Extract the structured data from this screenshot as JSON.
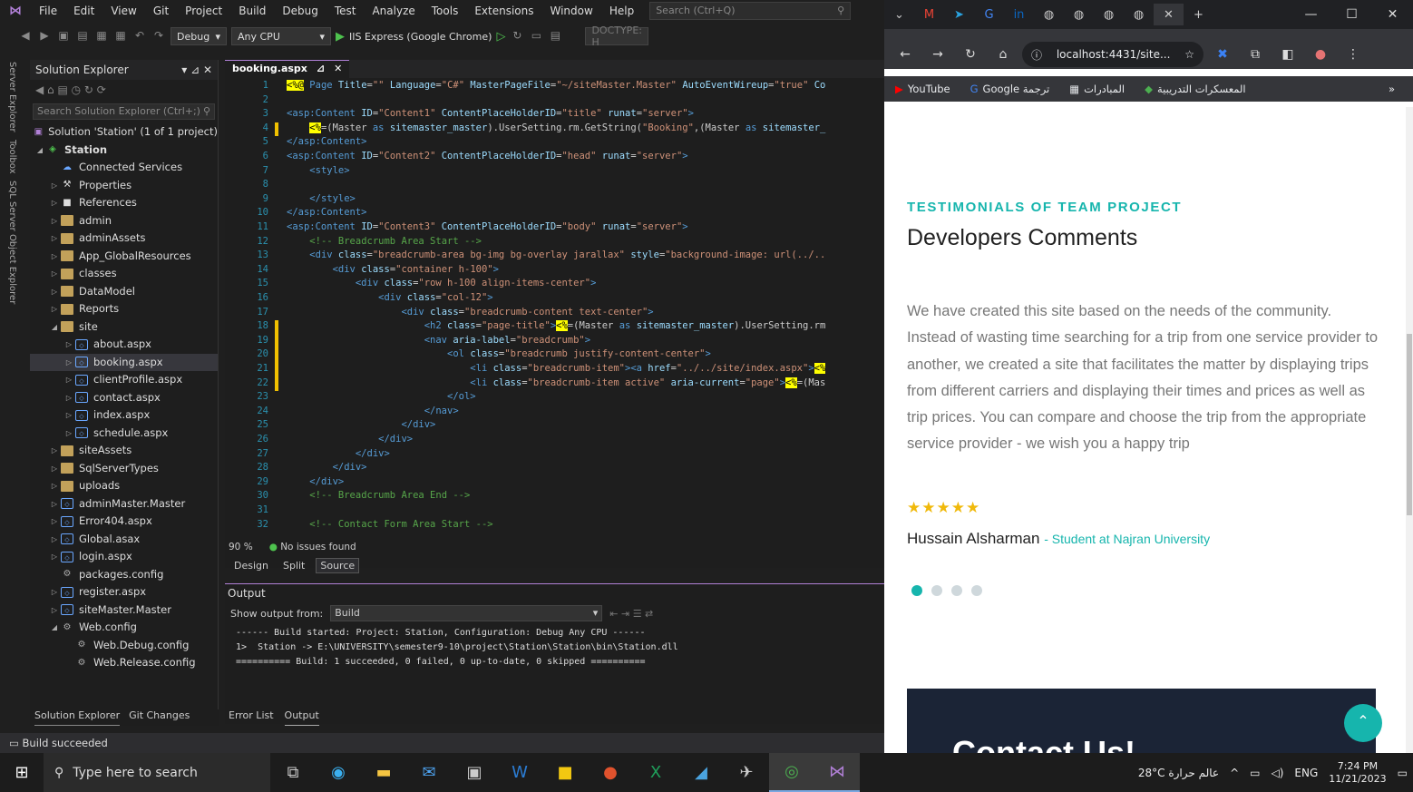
{
  "vs": {
    "menus": [
      "File",
      "Edit",
      "View",
      "Git",
      "Project",
      "Build",
      "Debug",
      "Test",
      "Analyze",
      "Tools",
      "Extensions",
      "Window",
      "Help"
    ],
    "search_placeholder": "Search (Ctrl+Q)",
    "config": "Debug",
    "platform": "Any CPU",
    "run_target": "IIS Express (Google Chrome)",
    "doctype": "DOCTYPE: H",
    "side_tabs": [
      "Server Explorer",
      "Toolbox",
      "SQL Server Object Explorer"
    ],
    "solution_explorer": {
      "title": "Solution Explorer",
      "search": "Search Solution Explorer (Ctrl+;)",
      "items": [
        {
          "label": "Solution 'Station' (1 of 1 project)",
          "lvl": 0,
          "kind": "sol",
          "tw": ""
        },
        {
          "label": "Station",
          "lvl": 0,
          "kind": "proj",
          "tw": "◢"
        },
        {
          "label": "Connected Services",
          "lvl": 1,
          "kind": "svc",
          "tw": ""
        },
        {
          "label": "Properties",
          "lvl": 1,
          "kind": "prop",
          "tw": "▷"
        },
        {
          "label": "References",
          "lvl": 1,
          "kind": "ref",
          "tw": "▷"
        },
        {
          "label": "admin",
          "lvl": 1,
          "kind": "folder",
          "tw": "▷"
        },
        {
          "label": "adminAssets",
          "lvl": 1,
          "kind": "folder",
          "tw": "▷"
        },
        {
          "label": "App_GlobalResources",
          "lvl": 1,
          "kind": "folder",
          "tw": "▷"
        },
        {
          "label": "classes",
          "lvl": 1,
          "kind": "folder",
          "tw": "▷"
        },
        {
          "label": "DataModel",
          "lvl": 1,
          "kind": "folder",
          "tw": "▷"
        },
        {
          "label": "Reports",
          "lvl": 1,
          "kind": "folder",
          "tw": "▷"
        },
        {
          "label": "site",
          "lvl": 1,
          "kind": "folder",
          "tw": "◢"
        },
        {
          "label": "about.aspx",
          "lvl": 2,
          "kind": "file",
          "tw": "▷"
        },
        {
          "label": "booking.aspx",
          "lvl": 2,
          "kind": "file",
          "tw": "▷",
          "sel": true
        },
        {
          "label": "clientProfile.aspx",
          "lvl": 2,
          "kind": "file",
          "tw": "▷"
        },
        {
          "label": "contact.aspx",
          "lvl": 2,
          "kind": "file",
          "tw": "▷"
        },
        {
          "label": "index.aspx",
          "lvl": 2,
          "kind": "file",
          "tw": "▷"
        },
        {
          "label": "schedule.aspx",
          "lvl": 2,
          "kind": "file",
          "tw": "▷"
        },
        {
          "label": "siteAssets",
          "lvl": 1,
          "kind": "folder",
          "tw": "▷"
        },
        {
          "label": "SqlServerTypes",
          "lvl": 1,
          "kind": "folder",
          "tw": "▷"
        },
        {
          "label": "uploads",
          "lvl": 1,
          "kind": "folder",
          "tw": "▷"
        },
        {
          "label": "adminMaster.Master",
          "lvl": 1,
          "kind": "file",
          "tw": "▷"
        },
        {
          "label": "Error404.aspx",
          "lvl": 1,
          "kind": "file",
          "tw": "▷"
        },
        {
          "label": "Global.asax",
          "lvl": 1,
          "kind": "file",
          "tw": "▷"
        },
        {
          "label": "login.aspx",
          "lvl": 1,
          "kind": "file",
          "tw": "▷"
        },
        {
          "label": "packages.config",
          "lvl": 1,
          "kind": "cfg",
          "tw": ""
        },
        {
          "label": "register.aspx",
          "lvl": 1,
          "kind": "file",
          "tw": "▷"
        },
        {
          "label": "siteMaster.Master",
          "lvl": 1,
          "kind": "file",
          "tw": "▷"
        },
        {
          "label": "Web.config",
          "lvl": 1,
          "kind": "cfg",
          "tw": "◢"
        },
        {
          "label": "Web.Debug.config",
          "lvl": 2,
          "kind": "cfg",
          "tw": ""
        },
        {
          "label": "Web.Release.config",
          "lvl": 2,
          "kind": "cfg",
          "tw": ""
        }
      ],
      "bottom_tabs": [
        "Solution Explorer",
        "Git Changes"
      ]
    },
    "editor": {
      "tab": "booking.aspx",
      "lines": [
        {
          "n": "1",
          "h": "<span class='yb'>&lt;%@</span> <span class='kw'>Page</span> <span class='at'>Title</span>=<span class='st'>\"\"</span> <span class='at'>Language</span>=<span class='st'>\"C#\"</span> <span class='at'>MasterPageFile</span>=<span class='st'>\"~/siteMaster.Master\"</span> <span class='at'>AutoEventWireup</span>=<span class='st'>\"true\"</span> <span class='at'>Co</span>"
        },
        {
          "n": "2",
          "h": ""
        },
        {
          "n": "3",
          "h": "<span class='kw'>&lt;asp:Content</span> <span class='at'>ID</span>=<span class='st'>\"Content1\"</span> <span class='at'>ContentPlaceHolderID</span>=<span class='st'>\"title\"</span> <span class='at'>runat</span>=<span class='st'>\"server\"</span><span class='kw'>&gt;</span>"
        },
        {
          "n": "4",
          "h": "    <span class='yb'>&lt;%</span>=(Master <span class='kw'>as</span> <span class='at'>sitemaster_master</span>).UserSetting.rm.GetString(<span class='st'>\"Booking\"</span>,(Master <span class='kw'>as</span> <span class='at'>sitemaster_</span>"
        },
        {
          "n": "5",
          "h": "<span class='kw'>&lt;/asp:Content&gt;</span>"
        },
        {
          "n": "6",
          "h": "<span class='kw'>&lt;asp:Content</span> <span class='at'>ID</span>=<span class='st'>\"Content2\"</span> <span class='at'>ContentPlaceHolderID</span>=<span class='st'>\"head\"</span> <span class='at'>runat</span>=<span class='st'>\"server\"</span><span class='kw'>&gt;</span>"
        },
        {
          "n": "7",
          "h": "    <span class='kw'>&lt;style&gt;</span>"
        },
        {
          "n": "8",
          "h": ""
        },
        {
          "n": "9",
          "h": "    <span class='kw'>&lt;/style&gt;</span>"
        },
        {
          "n": "10",
          "h": "<span class='kw'>&lt;/asp:Content&gt;</span>"
        },
        {
          "n": "11",
          "h": "<span class='kw'>&lt;asp:Content</span> <span class='at'>ID</span>=<span class='st'>\"Content3\"</span> <span class='at'>ContentPlaceHolderID</span>=<span class='st'>\"body\"</span> <span class='at'>runat</span>=<span class='st'>\"server\"</span><span class='kw'>&gt;</span>"
        },
        {
          "n": "12",
          "h": "    <span class='cm'>&lt;!-- Breadcrumb Area Start --&gt;</span>"
        },
        {
          "n": "13",
          "h": "    <span class='kw'>&lt;div</span> <span class='at'>class</span>=<span class='st'>\"breadcrumb-area bg-img bg-overlay jarallax\"</span> <span class='at'>style</span>=<span class='st'>\"background-image: url(../..</span>"
        },
        {
          "n": "14",
          "h": "        <span class='kw'>&lt;div</span> <span class='at'>class</span>=<span class='st'>\"container h-100\"</span><span class='kw'>&gt;</span>"
        },
        {
          "n": "15",
          "h": "            <span class='kw'>&lt;div</span> <span class='at'>class</span>=<span class='st'>\"row h-100 align-items-center\"</span><span class='kw'>&gt;</span>"
        },
        {
          "n": "16",
          "h": "                <span class='kw'>&lt;div</span> <span class='at'>class</span>=<span class='st'>\"col-12\"</span><span class='kw'>&gt;</span>"
        },
        {
          "n": "17",
          "h": "                    <span class='kw'>&lt;div</span> <span class='at'>class</span>=<span class='st'>\"breadcrumb-content text-center\"</span><span class='kw'>&gt;</span>"
        },
        {
          "n": "18",
          "h": "                        <span class='kw'>&lt;h2</span> <span class='at'>class</span>=<span class='st'>\"page-title\"</span><span class='kw'>&gt;</span><span class='yb'>&lt;%</span>=(Master <span class='kw'>as</span> <span class='at'>sitemaster_master</span>).UserSetting.rm"
        },
        {
          "n": "19",
          "h": "                        <span class='kw'>&lt;nav</span> <span class='at'>aria-label</span>=<span class='st'>\"breadcrumb\"</span><span class='kw'>&gt;</span>"
        },
        {
          "n": "20",
          "h": "                            <span class='kw'>&lt;ol</span> <span class='at'>class</span>=<span class='st'>\"breadcrumb justify-content-center\"</span><span class='kw'>&gt;</span>"
        },
        {
          "n": "21",
          "h": "                                <span class='kw'>&lt;li</span> <span class='at'>class</span>=<span class='st'>\"breadcrumb-item\"</span><span class='kw'>&gt;&lt;a</span> <span class='at'>href</span>=<span class='st'>\"../../site/index.aspx\"</span><span class='kw'>&gt;</span><span class='yb'>&lt;%</span>"
        },
        {
          "n": "22",
          "h": "                                <span class='kw'>&lt;li</span> <span class='at'>class</span>=<span class='st'>\"breadcrumb-item active\"</span> <span class='at'>aria-current</span>=<span class='st'>\"page\"</span><span class='kw'>&gt;</span><span class='yb'>&lt;%</span>=(Mas"
        },
        {
          "n": "23",
          "h": "                            <span class='kw'>&lt;/ol&gt;</span>"
        },
        {
          "n": "24",
          "h": "                        <span class='kw'>&lt;/nav&gt;</span>"
        },
        {
          "n": "25",
          "h": "                    <span class='kw'>&lt;/div&gt;</span>"
        },
        {
          "n": "26",
          "h": "                <span class='kw'>&lt;/div&gt;</span>"
        },
        {
          "n": "27",
          "h": "            <span class='kw'>&lt;/div&gt;</span>"
        },
        {
          "n": "28",
          "h": "        <span class='kw'>&lt;/div&gt;</span>"
        },
        {
          "n": "29",
          "h": "    <span class='kw'>&lt;/div&gt;</span>"
        },
        {
          "n": "30",
          "h": "    <span class='cm'>&lt;!-- Breadcrumb Area End --&gt;</span>"
        },
        {
          "n": "31",
          "h": ""
        },
        {
          "n": "32",
          "h": "    <span class='cm'>&lt;!-- Contact Form Area Start --&gt;</span>"
        }
      ],
      "zoom": "90 %",
      "issues": "No issues found",
      "view_tabs": [
        "Design",
        "Split",
        "Source"
      ]
    },
    "output": {
      "title": "Output",
      "show_from_label": "Show output from:",
      "source": "Build",
      "lines": [
        "------ Build started: Project: Station, Configuration: Debug Any CPU ------",
        "1>  Station -> E:\\UNIVERSITY\\semester9-10\\project\\Station\\Station\\bin\\Station.dll",
        "========== Build: 1 succeeded, 0 failed, 0 up-to-date, 0 skipped =========="
      ],
      "bottom_tabs": [
        "Error List",
        "Output"
      ]
    },
    "status": "Build succeeded"
  },
  "chrome": {
    "url": "localhost:4431/site...",
    "bookmarks": [
      "YouTube",
      "Google ترجمة",
      "المبادرات",
      "المعسكرات التدريبية"
    ],
    "page": {
      "kicker": "TESTIMONIALS OF TEAM PROJECT",
      "title": "Developers Comments",
      "body": "We have created this site based on the needs of the community. Instead of wasting time searching for a trip from one service provider to another, we created a site that facilitates the matter by displaying trips from different carriers and displaying their times and prices as well as trip prices. You can compare and choose the trip from the appropriate service provider - we wish you a happy trip",
      "rating": 5,
      "stars": "★★★★★",
      "author": "Hussain Alsharman",
      "role": "Student at Najran University",
      "slide_count": 4,
      "active_slide": 1,
      "contact_heading": "Contact Us!"
    }
  },
  "taskbar": {
    "search": "Type here to search",
    "weather": "28°C عالم حرارة",
    "lang": "ENG",
    "time": "7:24 PM",
    "date": "11/21/2023"
  }
}
